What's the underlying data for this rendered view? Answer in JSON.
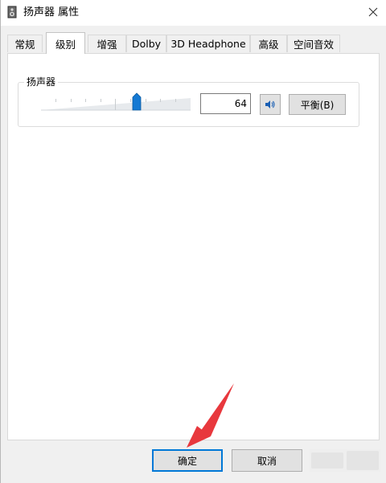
{
  "window": {
    "title": "扬声器 属性"
  },
  "tabs": [
    {
      "label": "常规",
      "active": false
    },
    {
      "label": "级别",
      "active": true
    },
    {
      "label": "增强",
      "active": false
    },
    {
      "label": "Dolby",
      "active": false
    },
    {
      "label": "3D Headphone",
      "active": false
    },
    {
      "label": "高级",
      "active": false
    },
    {
      "label": "空间音效",
      "active": false
    }
  ],
  "levels": {
    "group_label": "扬声器",
    "volume_value": "64",
    "volume_level": 64,
    "volume_max": 100,
    "mute_icon": "speaker-icon",
    "balance_label": "平衡(B)"
  },
  "buttons": {
    "ok_label": "确定",
    "cancel_label": "取消"
  },
  "colors": {
    "accent": "#0078d7",
    "annotation_arrow": "#e8383d"
  }
}
